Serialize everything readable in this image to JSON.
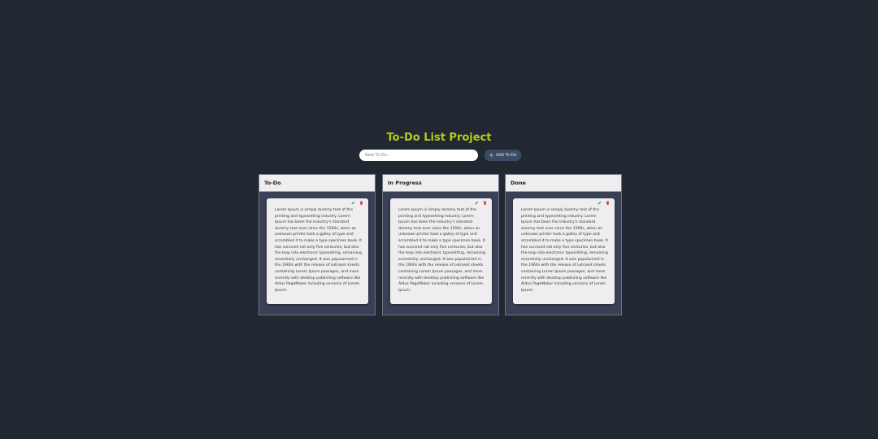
{
  "header": {
    "title": "To-Do List Project"
  },
  "input": {
    "placeholder": "New To-Do..."
  },
  "add_button": {
    "label": "Add To-Do",
    "icon": "plus-icon"
  },
  "columns": [
    {
      "title": "To-Do",
      "cards": [
        {
          "text": "Lorem Ipsum is simply dummy text of the printing and typesetting industry. Lorem Ipsum has been the industry's standard dummy text ever since the 1500s, when an unknown printer took a galley of type and scrambled it to make a type specimen book. It has survived not only five centuries, but also the leap into electronic typesetting, remaining essentially unchanged. It was popularised in the 1960s with the release of Letraset sheets containing Lorem Ipsum passages, and more recently with desktop publishing software like Aldus PageMaker including versions of Lorem Ipsum."
        }
      ]
    },
    {
      "title": "In Progress",
      "cards": [
        {
          "text": "Lorem Ipsum is simply dummy text of the printing and typesetting industry. Lorem Ipsum has been the industry's standard dummy text ever since the 1500s, when an unknown printer took a galley of type and scrambled it to make a type specimen book. It has survived not only five centuries, but also the leap into electronic typesetting, remaining essentially unchanged. It was popularised in the 1960s with the release of Letraset sheets containing Lorem Ipsum passages, and more recently with desktop publishing software like Aldus PageMaker including versions of Lorem Ipsum."
        }
      ]
    },
    {
      "title": "Done",
      "cards": [
        {
          "text": "Lorem Ipsum is simply dummy text of the printing and typesetting industry. Lorem Ipsum has been the industry's standard dummy text ever since the 1500s, when an unknown printer took a galley of type and scrambled it to make a type specimen book. It has survived not only five centuries, but also the leap into electronic typesetting, remaining essentially unchanged. It was popularised in the 1960s with the release of Letraset sheets containing Lorem Ipsum passages, and more recently with desktop publishing software like Aldus PageMaker including versions of Lorem Ipsum."
        }
      ]
    }
  ],
  "colors": {
    "background": "#222831",
    "accent": "#b5cc18",
    "edit": "#2e7d32",
    "delete": "#d32f2f"
  }
}
